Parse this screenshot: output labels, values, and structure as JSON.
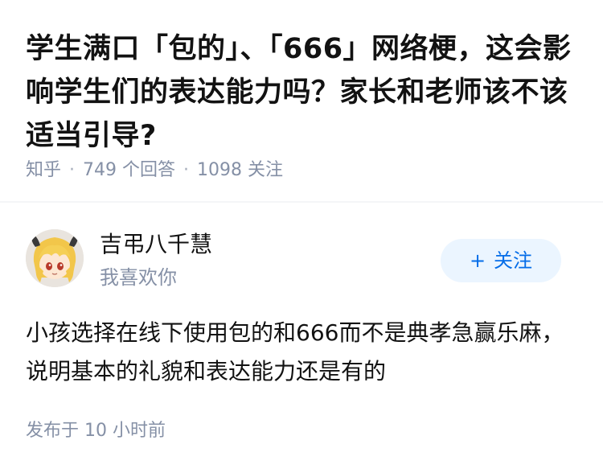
{
  "question": {
    "title": "学生满口「包的」、「666」网络梗，这会影响学生们的表达能力吗？家长和老师该不该适当引导?",
    "source": "知乎",
    "answer_count": "749 个回答",
    "follower_count": "1098 关注"
  },
  "answer": {
    "author": {
      "name": "吉弔八千慧",
      "bio": "我喜欢你",
      "avatar_icon": "anime-character-avatar"
    },
    "follow_button": {
      "plus": "+",
      "label": "关注"
    },
    "content": "小孩选择在线下使用包的和666而不是典孝急赢乐麻，说明基本的礼貌和表达能力还是有的",
    "publish_time": "发布于 10 小时前"
  },
  "colors": {
    "accent": "#056de8",
    "accent_bg": "#ebf5ff",
    "meta_text": "#8590a6",
    "main_text": "#121212"
  }
}
